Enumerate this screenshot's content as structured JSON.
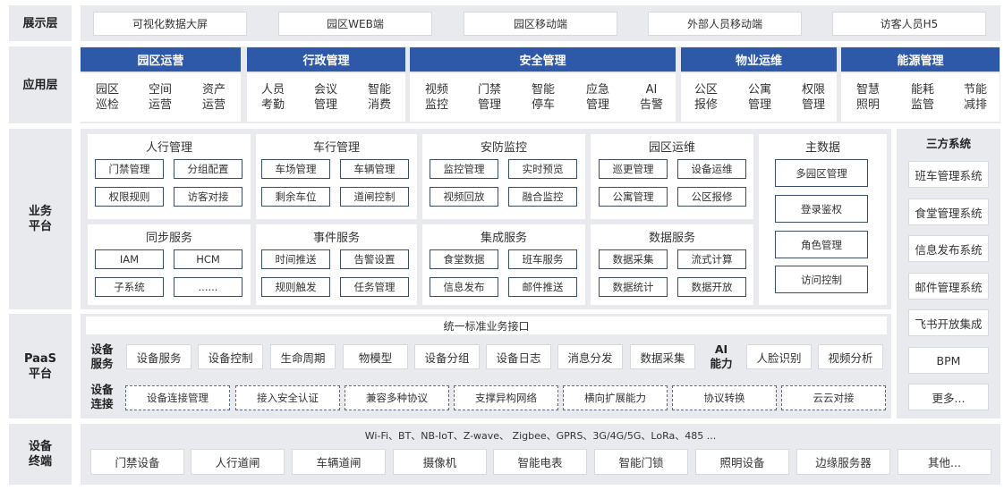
{
  "layers": {
    "display": "展示层",
    "app": "应用层",
    "biz": "业务\n平台",
    "paas": "PaaS\n平台",
    "device": "设备\n终端"
  },
  "display_items": [
    "可视化数据大屏",
    "园区WEB端",
    "园区移动端",
    "外部人员移动端",
    "访客人员H5"
  ],
  "app_groups": [
    {
      "title": "园区运营",
      "items": [
        "园区\n巡检",
        "空间\n运营",
        "资产\n运营"
      ]
    },
    {
      "title": "行政管理",
      "items": [
        "人员\n考勤",
        "会议\n管理",
        "智能\n消费"
      ]
    },
    {
      "title": "安全管理",
      "items": [
        "视频\n监控",
        "门禁\n管理",
        "智能\n停车",
        "应急\n管理",
        "AI\n告警"
      ]
    },
    {
      "title": "物业运维",
      "items": [
        "公区\n报修",
        "公寓\n管理",
        "权限\n管理"
      ]
    },
    {
      "title": "能源管理",
      "items": [
        "智慧\n照明",
        "能耗\n监管",
        "节能\n减排"
      ]
    }
  ],
  "biz_panels": [
    {
      "title": "人行管理",
      "items": [
        "门禁管理",
        "分组配置",
        "权限规则",
        "访客对接"
      ]
    },
    {
      "title": "车行管理",
      "items": [
        "车场管理",
        "车辆管理",
        "剩余车位",
        "道闸控制"
      ]
    },
    {
      "title": "安防监控",
      "items": [
        "监控管理",
        "实时预览",
        "视频回放",
        "融合监控"
      ]
    },
    {
      "title": "园区运维",
      "items": [
        "巡更管理",
        "设备运维",
        "公寓管理",
        "公区报修"
      ]
    },
    {
      "title": "同步服务",
      "items": [
        "IAM",
        "HCM",
        "子系统",
        "......"
      ]
    },
    {
      "title": "事件服务",
      "items": [
        "时间推送",
        "告警设置",
        "规则触发",
        "任务管理"
      ]
    },
    {
      "title": "集成服务",
      "items": [
        "食堂数据",
        "班车服务",
        "信息发布",
        "邮件推送"
      ]
    },
    {
      "title": "数据服务",
      "items": [
        "数据采集",
        "流式计算",
        "数据统计",
        "数据开放"
      ]
    }
  ],
  "master_data": {
    "title": "主数据",
    "items": [
      "多园区管理",
      "登录鉴权",
      "角色管理",
      "访问控制"
    ]
  },
  "third_party": {
    "title": "三方系统",
    "items": [
      "班车管理系统",
      "食堂管理系统",
      "信息发布系统",
      "邮件管理系统",
      "飞书开放集成",
      "BPM",
      "更多..."
    ]
  },
  "paas": {
    "interface": "统一标准业务接口",
    "device_service_label": "设备\n服务",
    "device_service_items": [
      "设备服务",
      "设备控制",
      "生命周期",
      "物模型",
      "设备分组",
      "设备日志",
      "消息分发",
      "数据采集"
    ],
    "ai_label": "AI\n能力",
    "ai_items": [
      "人脸识别",
      "视频分析"
    ],
    "device_conn_label": "设备\n连接",
    "device_conn_items": [
      "设备连接管理",
      "接入安全认证",
      "兼容多种协议",
      "支撑异构网络",
      "横向扩展能力",
      "协议转换",
      "云云对接"
    ]
  },
  "device": {
    "protocols": "Wi-Fi、BT、NB-IoT、Z-wave、 Zigbee、GPRS、3G/4G/5G、LoRa、485 ...",
    "items": [
      "门禁设备",
      "人行道闸",
      "车辆道闸",
      "摄像机",
      "智能电表",
      "智能门锁",
      "照明设备",
      "边缘服务器",
      "其他..."
    ]
  },
  "colors": {
    "header_blue": "#2e59a8",
    "band_gray": "#e8eaee",
    "box_border": "#3d4c66"
  }
}
